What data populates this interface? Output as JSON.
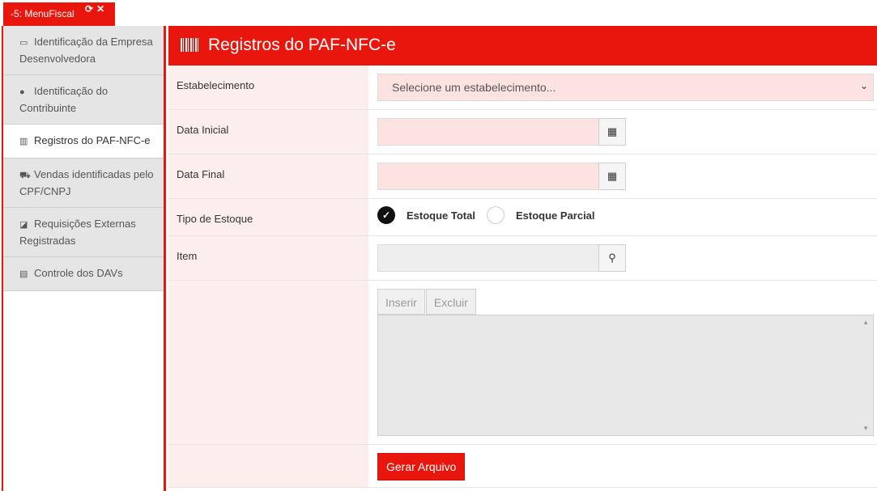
{
  "tab": {
    "label": "-5: MenuFiscal",
    "refresh_icon": "refresh-icon",
    "close_icon": "close-icon"
  },
  "sidebar": {
    "items": [
      {
        "label": "Identificação da Empresa Desenvolvedora",
        "icon": "monitor-icon"
      },
      {
        "label": "Identificação do Contribuinte",
        "icon": "info-icon"
      },
      {
        "label": "Registros do PAF-NFC-e",
        "icon": "barcode-icon"
      },
      {
        "label": "Vendas identificadas pelo CPF/CNPJ",
        "icon": "cart-icon"
      },
      {
        "label": "Requisições Externas Registradas",
        "icon": "external-link-icon"
      },
      {
        "label": "Controle dos DAVs",
        "icon": "file-icon"
      }
    ]
  },
  "header": {
    "title": "Registros do PAF-NFC-e"
  },
  "form": {
    "estabelecimento": {
      "label": "Estabelecimento",
      "placeholder": "Selecione um estabelecimento..."
    },
    "data_inicial": {
      "label": "Data Inicial",
      "value": ""
    },
    "data_final": {
      "label": "Data Final",
      "value": ""
    },
    "tipo_estoque": {
      "label": "Tipo de Estoque",
      "options": [
        "Estoque Total",
        "Estoque Parcial"
      ],
      "selected": "Estoque Total"
    },
    "item": {
      "label": "Item",
      "value": ""
    },
    "buttons": {
      "inserir": "Inserir",
      "excluir": "Excluir"
    },
    "gerar": "Gerar Arquivo"
  },
  "colors": {
    "accent": "#e8160c",
    "label_bg": "#fdeeee",
    "input_bg": "#fde2e2"
  }
}
